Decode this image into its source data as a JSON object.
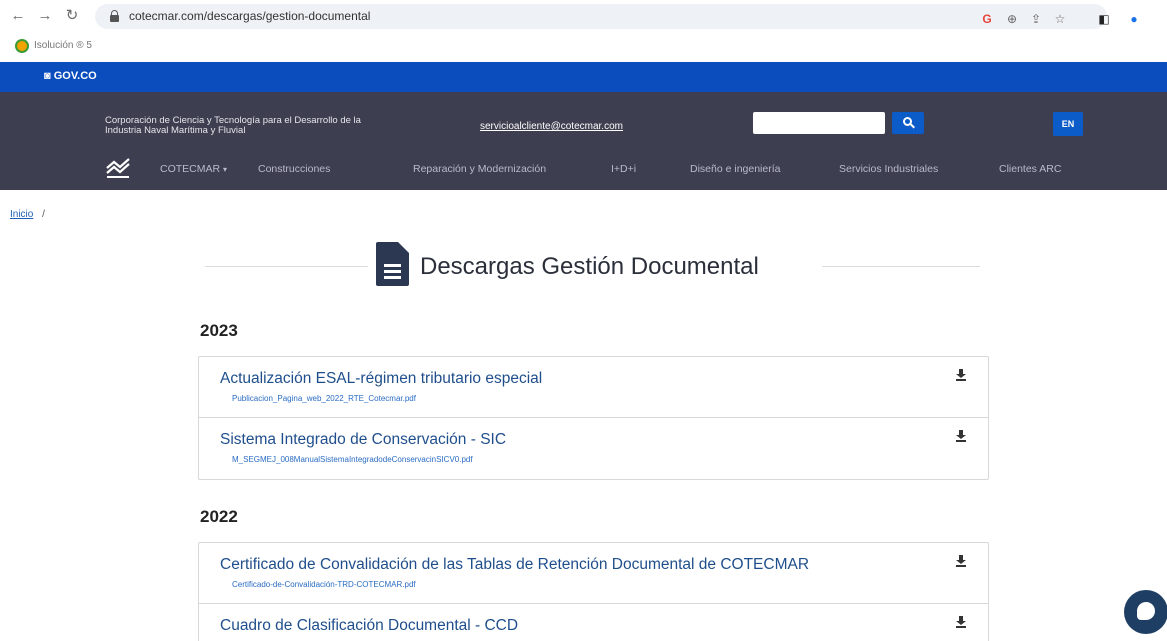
{
  "browser": {
    "url": "cotecmar.com/descargas/gestion-documental",
    "bookmark_label": "Isolución ® 5",
    "extension_g": "G"
  },
  "gov": {
    "logo": "GOV.CO"
  },
  "header": {
    "tagline": "Corporación de Ciencia y Tecnología para el Desarrollo de la Industria Naval Marítima y Fluvial",
    "email": "servicioalcliente@cotecmar.com",
    "lang_button": "EN",
    "menu": [
      "COTECMAR",
      "Construcciones",
      "Reparación y Modernización",
      "I+D+i",
      "Diseño e ingeniería",
      "Servicios Industriales",
      "Clientes ARC"
    ]
  },
  "breadcrumb": {
    "home": "Inicio",
    "separator": "/"
  },
  "page": {
    "title": "Descargas Gestión Documental"
  },
  "sections": [
    {
      "year": "2023",
      "documents": [
        {
          "title": "Actualización ESAL-régimen tributario especial",
          "file": "Publicacion_Pagina_web_2022_RTE_Cotecmar.pdf"
        },
        {
          "title": "Sistema Integrado de Conservación - SIC",
          "file": "M_SEGMEJ_008ManualSistemaIntegradodeConservacinSICV0.pdf"
        }
      ]
    },
    {
      "year": "2022",
      "documents": [
        {
          "title": "Certificado de Convalidación de las Tablas de Retención Documental de COTECMAR",
          "file": "Certificado-de-Convalidación-TRD-COTECMAR.pdf"
        },
        {
          "title": "Cuadro de Clasificación Documental - CCD",
          "file": ""
        }
      ]
    }
  ]
}
